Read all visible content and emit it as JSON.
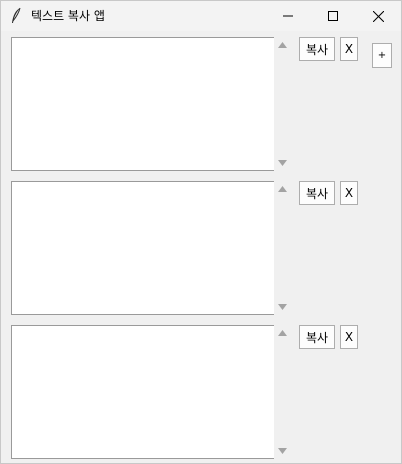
{
  "window": {
    "title": "텍스트 복사 앱",
    "app_icon": "feather-icon",
    "controls": {
      "minimize_icon": "minimize-icon",
      "maximize_icon": "maximize-icon",
      "close_icon": "close-icon"
    }
  },
  "add_button_label": "+",
  "panels": [
    {
      "text": "",
      "copy_label": "복사",
      "delete_label": "X"
    },
    {
      "text": "",
      "copy_label": "복사",
      "delete_label": "X"
    },
    {
      "text": "",
      "copy_label": "복사",
      "delete_label": "X"
    }
  ],
  "colors": {
    "window_bg": "#f0f0f0",
    "text_bg": "#ffffff",
    "button_border": "#adadad",
    "scroll_arrow": "#a3a3a3"
  }
}
